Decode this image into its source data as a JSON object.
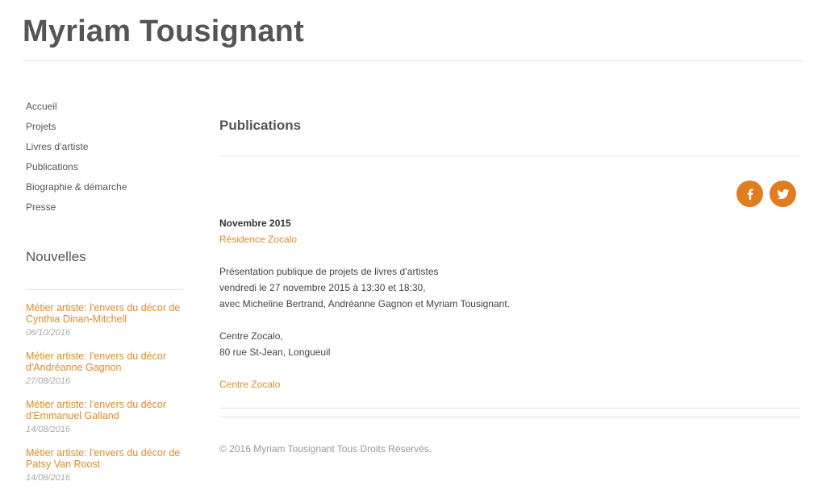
{
  "site": {
    "title": "Myriam Tousignant"
  },
  "nav": {
    "items": [
      {
        "label": "Accueil"
      },
      {
        "label": "Projets"
      },
      {
        "label": "Livres d’artiste"
      },
      {
        "label": "Publications"
      },
      {
        "label": "Biographie & démarche"
      },
      {
        "label": "Presse"
      }
    ]
  },
  "news": {
    "title": "Nouvelles",
    "items": [
      {
        "title": "Métier artiste: l'envers du décor de Cynthia Dinan-Mitchell",
        "date": "06/10/2016"
      },
      {
        "title": "Métier artiste: l'envers du décor d'Andréanne Gagnon",
        "date": "27/08/2016"
      },
      {
        "title": "Métier artiste: l'envers du décor d'Emmanuel Galland",
        "date": "14/08/2016"
      },
      {
        "title": "Métier artiste: l'envers du décor de Patsy Van Roost",
        "date": "14/08/2016"
      }
    ]
  },
  "main": {
    "page_title": "Publications",
    "social": {
      "facebook_icon": "facebook-icon",
      "twitter_icon": "twitter-icon",
      "accent": "#e07d1f"
    },
    "article": {
      "date": "Novembre 2015",
      "link1": "Résidence Zocalo",
      "line1": "Présentation publique de projets de livres d’artistes",
      "line2": "vendredi le 27 novembre 2015 à 13:30 et 18:30,",
      "line3": "avec Micheline Bertrand, Andréanne Gagnon et Myriam Tousignant.",
      "line4": "Centre Zocalo,",
      "line5": "80 rue St-Jean, Longueuil",
      "link2": "Centre Zocalo"
    }
  },
  "footer": {
    "text": "© 2016 Myriam Tousignant Tous Droits Réservés."
  }
}
